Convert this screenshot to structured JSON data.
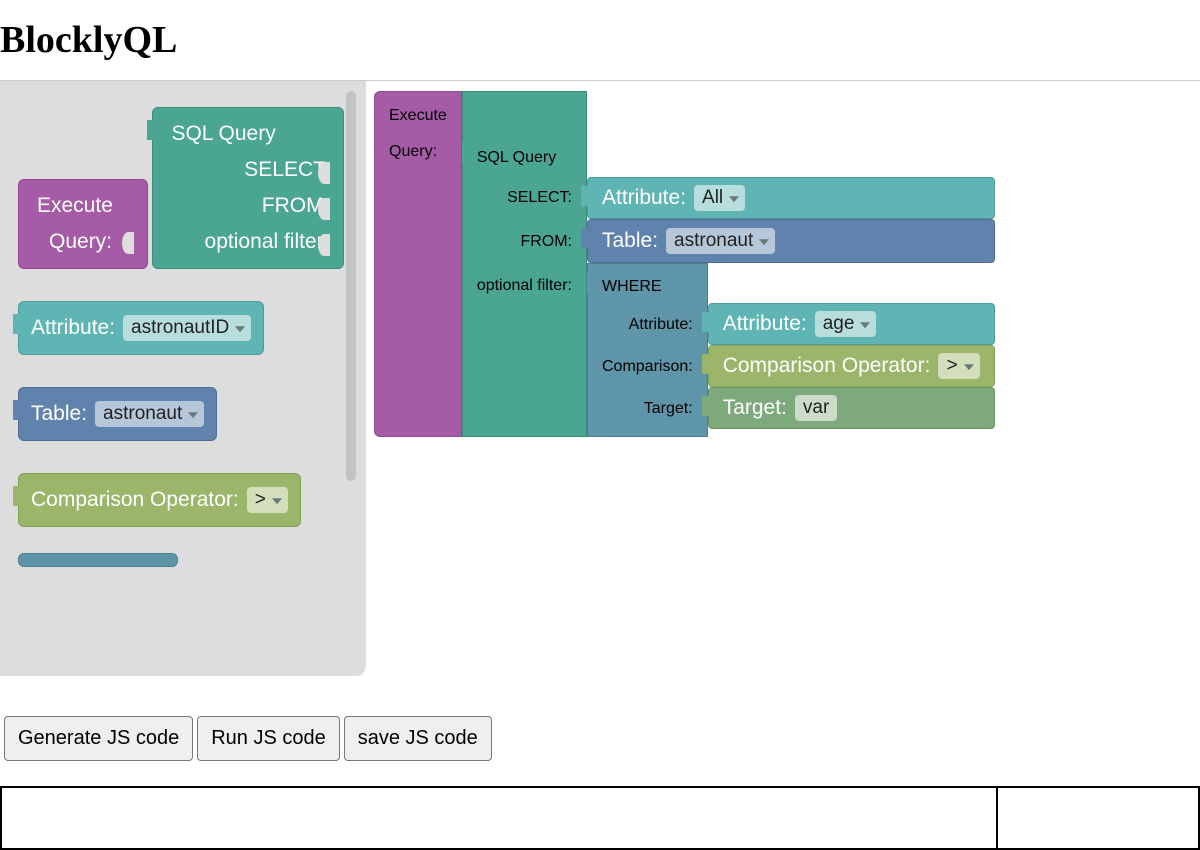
{
  "title": "BlocklyQL",
  "colors": {
    "purple": "#a55ba5",
    "green": "#4aa592",
    "teal": "#5fb4b4",
    "blue": "#5f83ad",
    "olive": "#9bb66a",
    "steel": "#5f95a9",
    "sage": "#7da97c"
  },
  "toolbox": {
    "execute": {
      "title": "Execute",
      "query_label": "Query:"
    },
    "sqlquery": {
      "title": "SQL Query",
      "select_label": "SELECT:",
      "from_label": "FROM:",
      "filter_label": "optional filter:"
    },
    "attribute": {
      "label": "Attribute:",
      "value": "astronautID"
    },
    "table": {
      "label": "Table:",
      "value": "astronaut"
    },
    "comparison": {
      "label": "Comparison Operator:",
      "value": ">"
    }
  },
  "canvas": {
    "execute": {
      "title": "Execute",
      "query_label": "Query:"
    },
    "sqlquery": {
      "title": "SQL Query",
      "select_label": "SELECT:",
      "from_label": "FROM:",
      "filter_label": "optional filter:"
    },
    "select_attr": {
      "label": "Attribute:",
      "value": "All"
    },
    "from_table": {
      "label": "Table:",
      "value": "astronaut"
    },
    "where": {
      "title": "WHERE",
      "attr_label": "Attribute:",
      "comp_label": "Comparison:",
      "target_label": "Target:"
    },
    "where_attr": {
      "label": "Attribute:",
      "value": "age"
    },
    "where_comp": {
      "label": "Comparison Operator:",
      "value": ">"
    },
    "where_target": {
      "label": "Target:",
      "value": "var"
    }
  },
  "buttons": {
    "generate": "Generate JS code",
    "run": "Run JS code",
    "save": "save JS code"
  }
}
